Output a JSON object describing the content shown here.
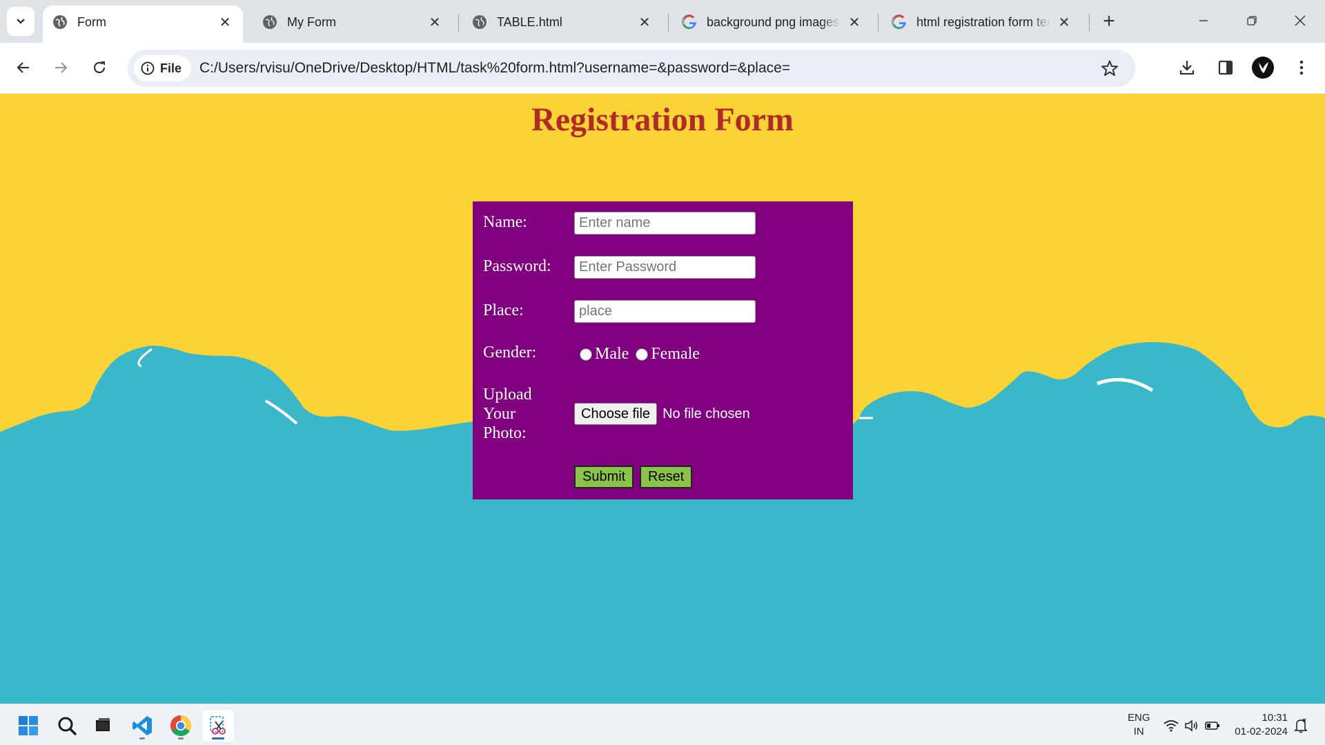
{
  "browser": {
    "tabs": [
      {
        "title": "Form",
        "favicon": "globe-icon",
        "active": true
      },
      {
        "title": "My Form",
        "favicon": "globe-icon",
        "active": false
      },
      {
        "title": "TABLE.html",
        "favicon": "globe-icon",
        "active": false
      },
      {
        "title": "background png images f",
        "favicon": "google-icon",
        "active": false
      },
      {
        "title": "html registration form ten",
        "favicon": "google-icon",
        "active": false
      }
    ],
    "address": {
      "chip_label": "File",
      "url": "C:/Users/rvisu/OneDrive/Desktop/HTML/task%20form.html?username=&password=&place="
    }
  },
  "page": {
    "title": "Registration Form",
    "form": {
      "name_label": "Name:",
      "name_placeholder": "Enter name",
      "password_label": "Password:",
      "password_placeholder": "Enter Password",
      "place_label": "Place:",
      "place_placeholder": "place",
      "gender_label": "Gender:",
      "gender_options": [
        "Male",
        "Female"
      ],
      "upload_label_lines": [
        "Upload",
        "Your",
        "Photo:"
      ],
      "file_button": "Choose file",
      "file_status": "No file chosen",
      "submit": "Submit",
      "reset": "Reset"
    },
    "colors": {
      "sky": "#fbd335",
      "clouds": "#3ab8c9",
      "form_bg": "#800080",
      "title": "#b12a2a",
      "buttons": "#8bc34a"
    }
  },
  "taskbar": {
    "apps": [
      "windows-start-icon",
      "search-icon",
      "file-explorer-icon",
      "vscode-icon",
      "chrome-icon",
      "snipping-tool-icon"
    ],
    "language": [
      "ENG",
      "IN"
    ],
    "time": "10:31",
    "date": "01-02-2024"
  }
}
